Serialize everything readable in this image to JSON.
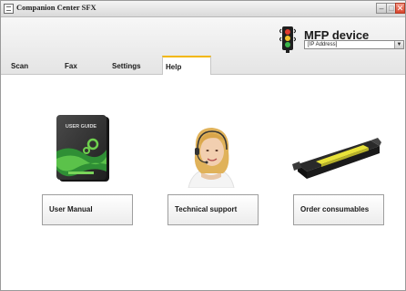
{
  "window": {
    "title": "Companion Center SFX"
  },
  "device": {
    "title": "MFP device",
    "selector_value": "[IP Address]"
  },
  "tabs": [
    {
      "label": "Scan"
    },
    {
      "label": "Fax"
    },
    {
      "label": "Settings"
    },
    {
      "label": "Help",
      "active": true
    }
  ],
  "help": {
    "user_guide_cover_text": "USER GUIDE",
    "buttons": {
      "user_manual": "User Manual",
      "technical_support": "Technical support",
      "order_consumables": "Order consumables"
    }
  },
  "icons": [
    "app-icon",
    "minimize-icon",
    "maximize-icon",
    "close-icon",
    "traffic-light-icon",
    "dropdown-arrow-icon",
    "user-guide-book-icon",
    "support-agent-image",
    "toner-cartridge-image"
  ],
  "colors": {
    "active_tab_accent": "#f2b705",
    "close_button": "#d9442b",
    "guide_green": "#3aa63a",
    "toner_yellow": "#e8e23a"
  }
}
